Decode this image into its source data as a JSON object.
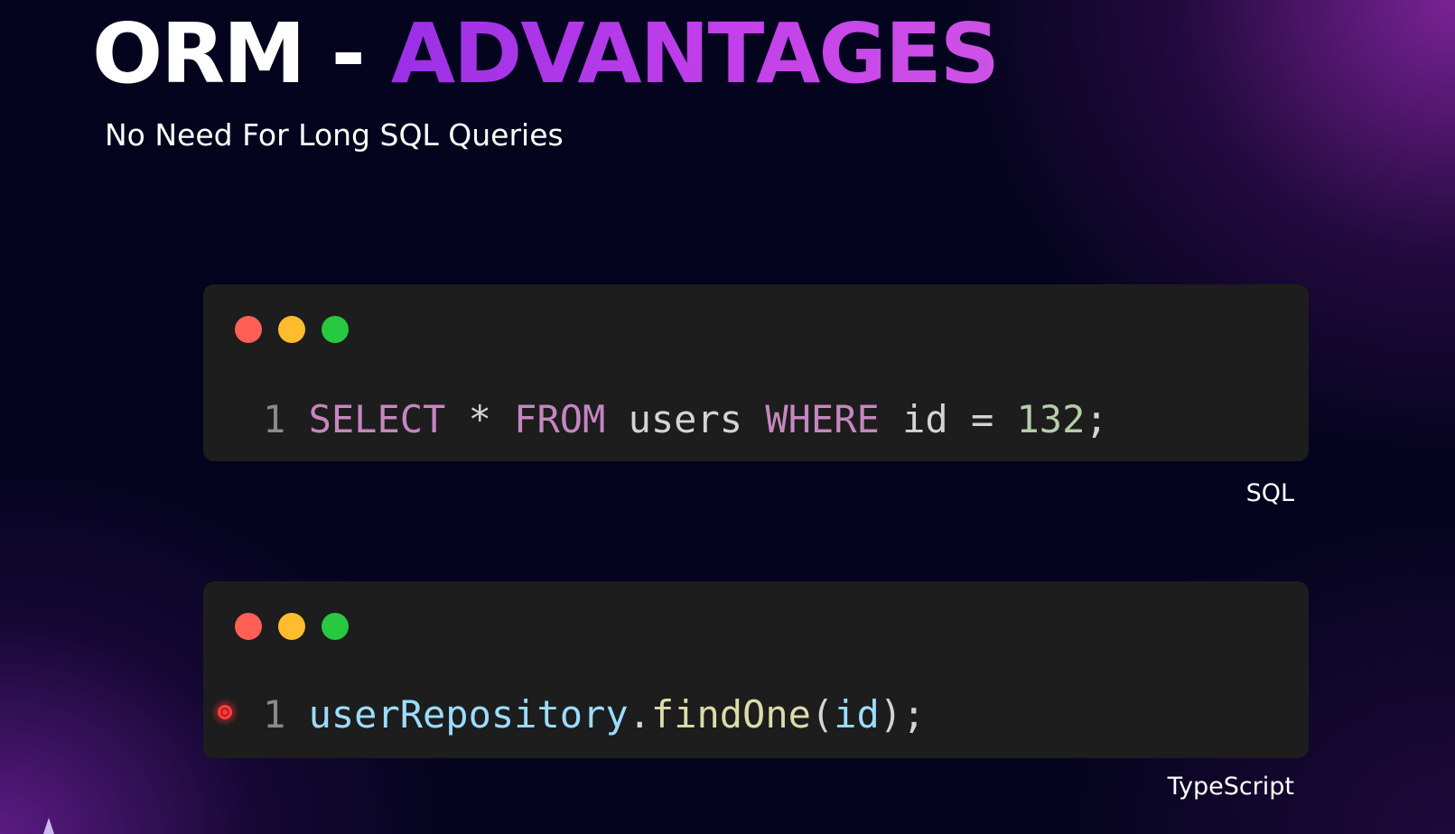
{
  "slide": {
    "title_part1": "ORM",
    "title_dash": " - ",
    "title_part2": "ADVANTAGES",
    "subtitle": "No Need For Long SQL Queries"
  },
  "sql_block": {
    "language_label": "SQL",
    "line_number": "1",
    "tokens": {
      "select": "SELECT",
      "star": " * ",
      "from": "FROM",
      "table": " users ",
      "where": "WHERE",
      "column": " id ",
      "equals": "= ",
      "number": "132",
      "semicolon": ";"
    }
  },
  "ts_block": {
    "language_label": "TypeScript",
    "line_number": "1",
    "tokens": {
      "object": "userRepository",
      "dot": ".",
      "method": "findOne",
      "open_paren": "(",
      "arg": "id",
      "close_paren": ");"
    }
  },
  "colors": {
    "background": "#04041e",
    "title_accent": "#c03ee8",
    "code_bg": "#1d1d1d",
    "window_red": "#fe5f57",
    "window_yellow": "#febc2e",
    "window_green": "#28c840"
  }
}
